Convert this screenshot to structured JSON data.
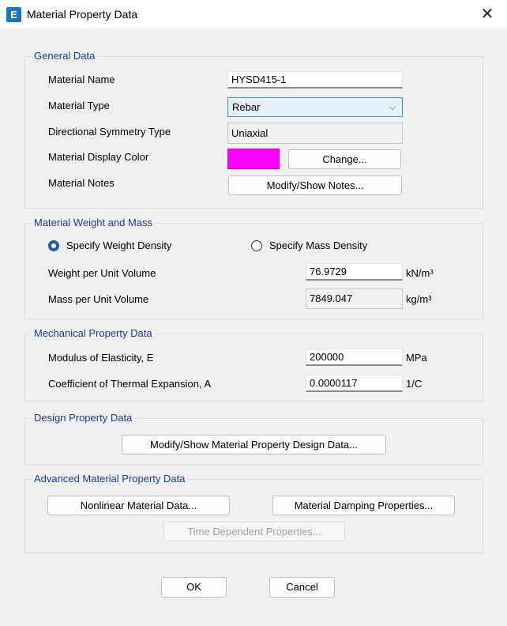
{
  "window": {
    "title": "Material Property Data",
    "app_icon_letter": "E",
    "close_icon": "close-icon"
  },
  "general": {
    "legend": "General Data",
    "material_name_label": "Material Name",
    "material_name_value": "HYSD415-1",
    "material_type_label": "Material Type",
    "material_type_value": "Rebar",
    "symmetry_label": "Directional Symmetry Type",
    "symmetry_value": "Uniaxial",
    "display_color_label": "Material Display Color",
    "display_color": "#ff00ff",
    "change_button": "Change...",
    "notes_label": "Material Notes",
    "notes_button": "Modify/Show Notes..."
  },
  "weight": {
    "legend": "Material Weight and Mass",
    "radio_weight": "Specify Weight Density",
    "radio_mass": "Specify Mass Density",
    "selected": "Specify Weight Density",
    "weight_label": "Weight per Unit Volume",
    "weight_value": "76.9729",
    "weight_unit": "kN/m³",
    "mass_label": "Mass per Unit Volume",
    "mass_value": "7849.047",
    "mass_unit": "kg/m³"
  },
  "mechanical": {
    "legend": "Mechanical Property Data",
    "modulus_label": "Modulus of Elasticity,  E",
    "modulus_value": "200000",
    "modulus_unit": "MPa",
    "thermal_label": "Coefficient of Thermal Expansion,  A",
    "thermal_value": "0.0000117",
    "thermal_unit": "1/C"
  },
  "design": {
    "legend": "Design Property Data",
    "design_button": "Modify/Show Material Property Design Data..."
  },
  "advanced": {
    "legend": "Advanced Material Property Data",
    "nonlinear_button": "Nonlinear Material Data...",
    "damping_button": "Material Damping Properties...",
    "time_button": "Time Dependent Properties..."
  },
  "footer": {
    "ok_button": "OK",
    "cancel_button": "Cancel"
  }
}
